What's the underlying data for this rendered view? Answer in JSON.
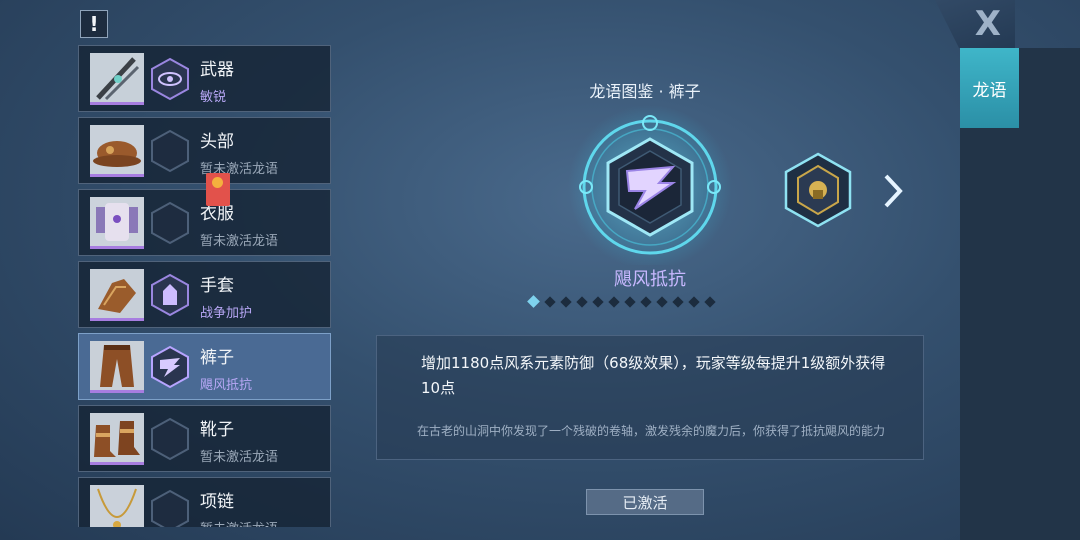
{
  "info_icon": "!",
  "close_label": "X",
  "side_tab_label": "龙语",
  "codex_title": "龙语图鉴 · 裤子",
  "emblem_name": "飓风抵抗",
  "effect_text": "增加1180点风系元素防御（68级效果），玩家等级每提升1级额外获得10点",
  "lore_text": "在古老的山洞中你发现了一个残破的卷轴，激发残余的魔力后，你获得了抵抗飓风的能力",
  "status_button_label": "已激活",
  "pagination": {
    "total": 12,
    "active_index": 0
  },
  "items": [
    {
      "name": "武器",
      "sub": "敏锐",
      "active": true,
      "icon": "eye-rune-icon"
    },
    {
      "name": "头部",
      "sub": "暂未激活龙语",
      "active": false,
      "icon": "empty-hex-icon"
    },
    {
      "name": "衣服",
      "sub": "暂未激活龙语",
      "active": false,
      "icon": "empty-hex-icon"
    },
    {
      "name": "手套",
      "sub": "战争加护",
      "active": true,
      "icon": "warrior-rune-icon"
    },
    {
      "name": "裤子",
      "sub": "飓风抵抗",
      "active": true,
      "icon": "wind-rune-icon",
      "selected": true
    },
    {
      "name": "靴子",
      "sub": "暂未激活龙语",
      "active": false,
      "icon": "empty-hex-icon"
    },
    {
      "name": "项链",
      "sub": "暂未激活龙语",
      "active": false,
      "icon": "empty-hex-icon"
    }
  ],
  "colors": {
    "accent_teal": "#3fb6c9",
    "active_purple": "#b7a7f5",
    "inactive_gray": "#9aa8b8"
  }
}
